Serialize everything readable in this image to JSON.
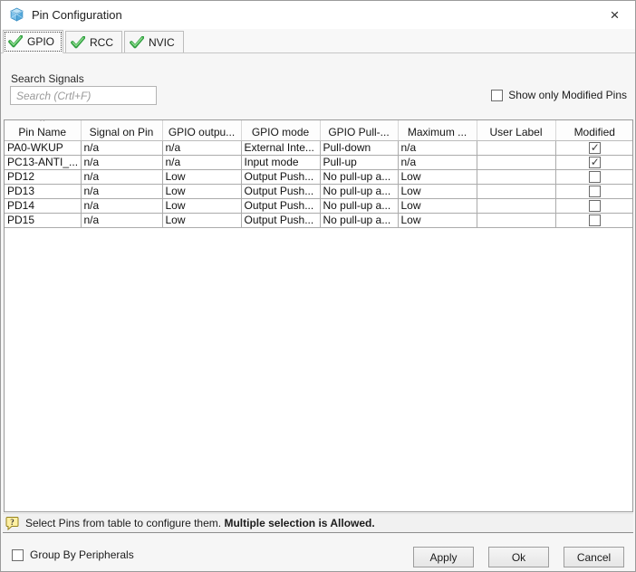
{
  "window": {
    "title": "Pin Configuration",
    "close_glyph": "×"
  },
  "tabs": [
    {
      "label": "GPIO",
      "selected": true
    },
    {
      "label": "RCC",
      "selected": false
    },
    {
      "label": "NVIC",
      "selected": false
    }
  ],
  "search": {
    "label": "Search Signals",
    "placeholder": "Search (Crtl+F)"
  },
  "show_only_modified": {
    "label": "Show only Modified Pins",
    "checked": false
  },
  "table": {
    "columns": [
      "Pin Name",
      "Signal on Pin",
      "GPIO outpu...",
      "GPIO mode",
      "GPIO Pull-...",
      "Maximum ...",
      "User Label",
      "Modified"
    ],
    "sort_column": "Pin Name",
    "sort_direction": "ascending",
    "rows": [
      {
        "cells": [
          "PA0-WKUP",
          "n/a",
          "n/a",
          "External Inte...",
          "Pull-down",
          "n/a",
          ""
        ],
        "modified": true
      },
      {
        "cells": [
          "PC13-ANTI_...",
          "n/a",
          "n/a",
          "Input mode",
          "Pull-up",
          "n/a",
          ""
        ],
        "modified": true
      },
      {
        "cells": [
          "PD12",
          "n/a",
          "Low",
          "Output Push...",
          "No pull-up a...",
          "Low",
          ""
        ],
        "modified": false
      },
      {
        "cells": [
          "PD13",
          "n/a",
          "Low",
          "Output Push...",
          "No pull-up a...",
          "Low",
          ""
        ],
        "modified": false
      },
      {
        "cells": [
          "PD14",
          "n/a",
          "Low",
          "Output Push...",
          "No pull-up a...",
          "Low",
          ""
        ],
        "modified": false
      },
      {
        "cells": [
          "PD15",
          "n/a",
          "Low",
          "Output Push...",
          "No pull-up a...",
          "Low",
          ""
        ],
        "modified": false
      }
    ]
  },
  "status": {
    "text_normal": "Select Pins from table to configure them. ",
    "text_bold": "Multiple selection is Allowed."
  },
  "footer": {
    "group_by_label": "Group By Peripherals",
    "group_by_checked": false,
    "apply_label": "Apply",
    "ok_label": "Ok",
    "cancel_label": "Cancel"
  },
  "colors": {
    "check_green": "#35a845",
    "check_green_light": "#8edc8e",
    "cube_blue": "#4d9fd6",
    "help_yellow": "#fff0a3",
    "help_border": "#96821c"
  }
}
